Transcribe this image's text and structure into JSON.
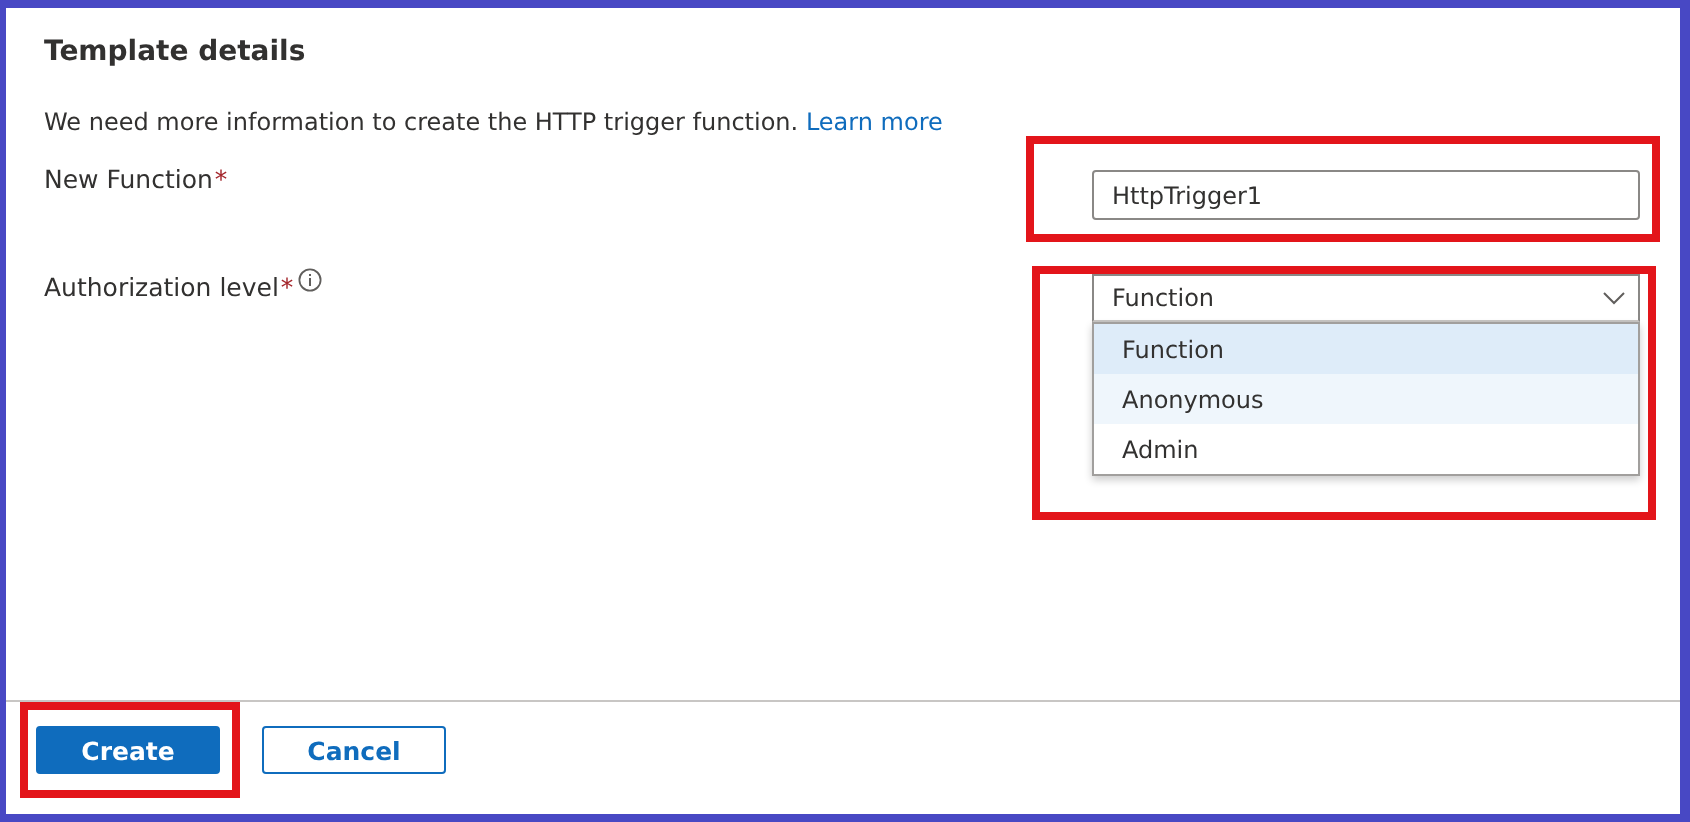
{
  "title": "Template details",
  "description": {
    "text": "We need more information to create the HTTP trigger function.",
    "link": "Learn more"
  },
  "fields": [
    {
      "kind": "text",
      "label": "New Function",
      "required_mark": "*",
      "value": "HttpTrigger1",
      "highlighted": true
    },
    {
      "kind": "dropdown",
      "label": "Authorization level",
      "required_mark": "*",
      "info": true,
      "value": "Function",
      "highlighted": true,
      "expanded": true,
      "options": [
        {
          "label": "Function",
          "selected": true,
          "hovered": false
        },
        {
          "label": "Anonymous",
          "selected": false,
          "hovered": true
        },
        {
          "label": "Admin",
          "selected": false,
          "hovered": false
        }
      ]
    }
  ],
  "buttons": [
    {
      "label": "Create",
      "kind": "primary",
      "highlighted": true
    },
    {
      "label": "Cancel",
      "kind": "secondary",
      "highlighted": false
    }
  ]
}
